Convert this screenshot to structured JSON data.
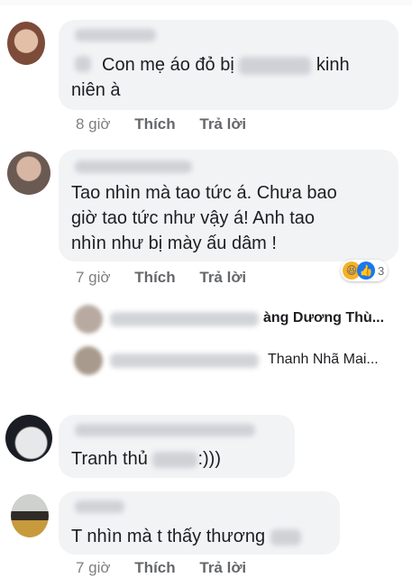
{
  "comments": [
    {
      "id": "c1",
      "text_line1": "Con mẹ áo đỏ bị",
      "text_line1_after": "kinh",
      "text_line2": "niên à",
      "time": "8 giờ",
      "like": "Thích",
      "reply": "Trả lời"
    },
    {
      "id": "c2",
      "text_line1": "Tao nhìn mà tao tức á. Chưa bao",
      "text_line2": "giờ tao tức như vậy á! Anh tao",
      "text_line3": "nhìn như bị mày ấu dâm !",
      "time": "7 giờ",
      "like": "Thích",
      "reply": "Trả lời",
      "reaction_count": "3",
      "replies": [
        {
          "tail": "àng Dương Thù..."
        },
        {
          "tail": "Thanh Nhã Mai..."
        }
      ]
    },
    {
      "id": "c3",
      "text_before": "Tranh thủ",
      "text_after": ":)))"
    },
    {
      "id": "c4",
      "text_before": "T nhìn mà t thấy thương",
      "time": "7 giờ",
      "like": "Thích",
      "reply": "Trả lời"
    }
  ],
  "colors": {
    "bubble": "#f2f3f5",
    "meta": "#7f7f7f",
    "reaction_like": "#1877f2",
    "reaction_haha": "#f7b125"
  },
  "icons": [
    "haha-reaction-icon",
    "like-reaction-icon"
  ]
}
